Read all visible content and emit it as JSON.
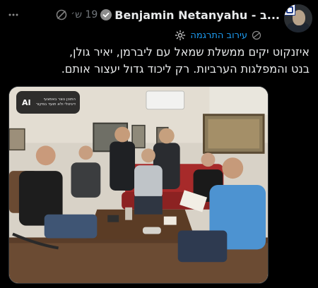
{
  "header": {
    "display_name": "Benjamin Netanyahu - ב...",
    "timestamp": "19 ש׳",
    "more_icon": "more-icon",
    "grok_icon": "grok-icon",
    "verified_icon": "verified-badge-icon"
  },
  "translate": {
    "label": "עירוב התרגמה"
  },
  "tweet": {
    "line1": "איזנקוט יקים ממשלת שמאל עם ליברמן, יאיר גולן,",
    "line2": "בנט והמפלגות הערביות. רק ליכוד גדול יעצור אותם."
  },
  "media": {
    "ai_badge_text": "התוכן נוצר באמצעי דיגיטלי ולא תועד במקור",
    "ai_label": "AI"
  },
  "colors": {
    "background": "#000000",
    "text": "#e7e9ea",
    "muted": "#71767b",
    "link": "#1d9bf0"
  }
}
